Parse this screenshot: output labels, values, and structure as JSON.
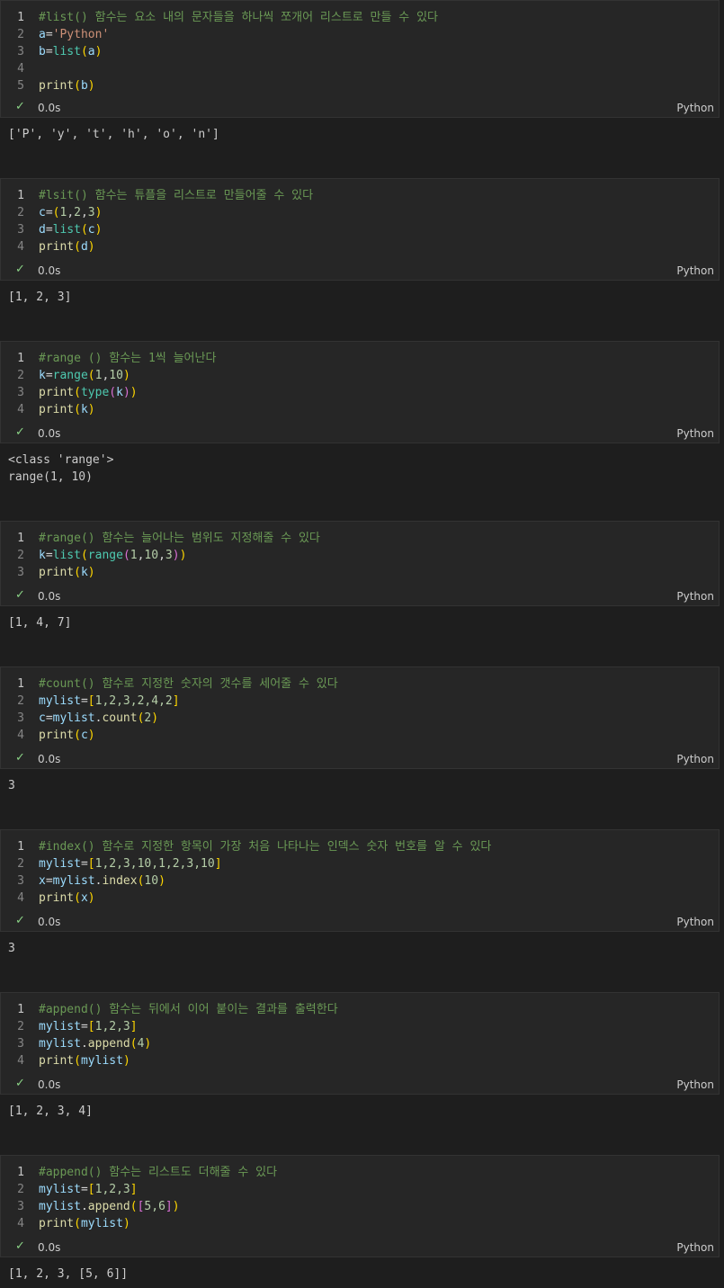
{
  "cells": [
    {
      "status": {
        "time": "0.0s",
        "language": "Python"
      },
      "output": [
        "['P', 'y', 't', 'h', 'o', 'n']"
      ]
    },
    {
      "status": {
        "time": "0.0s",
        "language": "Python"
      },
      "output": [
        "[1, 2, 3]"
      ]
    },
    {
      "status": {
        "time": "0.0s",
        "language": "Python"
      },
      "output": [
        "<class 'range'>",
        "range(1, 10)"
      ]
    },
    {
      "status": {
        "time": "0.0s",
        "language": "Python"
      },
      "output": [
        "[1, 4, 7]"
      ]
    },
    {
      "status": {
        "time": "0.0s",
        "language": "Python"
      },
      "output": [
        "3"
      ]
    },
    {
      "status": {
        "time": "0.0s",
        "language": "Python"
      },
      "output": [
        "3"
      ]
    },
    {
      "status": {
        "time": "0.0s",
        "language": "Python"
      },
      "output": [
        "[1, 2, 3, 4]"
      ]
    },
    {
      "status": {
        "time": "0.0s",
        "language": "Python"
      },
      "output": [
        "[1, 2, 3, [5, 6]]"
      ]
    }
  ],
  "code": {
    "c0": {
      "l1": {
        "cm": "#list() 함수는 요소 내의 문자들을 하나씩 쪼개어 리스트로 만들 수 있다"
      },
      "l2": {
        "a": "a",
        "eq": "=",
        "s": "'Python'"
      },
      "l3": {
        "b": "b",
        "eq": "=",
        "f": "list",
        "o": "(",
        "a": "a",
        "c": ")"
      },
      "l5": {
        "f": "print",
        "o": "(",
        "b": "b",
        "c": ")"
      }
    },
    "c1": {
      "l1": {
        "cm": "#lsit() 함수는 튜플을 리스트로 만들어줄 수 있다"
      },
      "l2": {
        "c": "c",
        "eq": "=",
        "o": "(",
        "n1": "1",
        "k1": ",",
        "n2": "2",
        "k2": ",",
        "n3": "3",
        "cl": ")"
      },
      "l3": {
        "d": "d",
        "eq": "=",
        "f": "list",
        "o": "(",
        "c": "c",
        "cl": ")"
      },
      "l4": {
        "f": "print",
        "o": "(",
        "d": "d",
        "cl": ")"
      }
    },
    "c2": {
      "l1": {
        "cm": "#range () 함수는 1씩 늘어난다"
      },
      "l2": {
        "k": "k",
        "eq": "=",
        "f": "range",
        "o": "(",
        "n1": "1",
        "k1": ",",
        "n2": "10",
        "cl": ")"
      },
      "l3": {
        "f": "print",
        "o": "(",
        "t": "type",
        "o2": "(",
        "k": "k",
        "c2": ")",
        "cl": ")"
      },
      "l4": {
        "f": "print",
        "o": "(",
        "k": "k",
        "cl": ")"
      }
    },
    "c3": {
      "l1": {
        "cm": "#range() 함수는 늘어나는 범위도 지정해줄 수 있다"
      },
      "l2": {
        "k": "k",
        "eq": "=",
        "f": "list",
        "o": "(",
        "r": "range",
        "o2": "(",
        "n1": "1",
        "k1": ",",
        "n2": "10",
        "k2": ",",
        "n3": "3",
        "c2": ")",
        "cl": ")"
      },
      "l3": {
        "f": "print",
        "o": "(",
        "k": "k",
        "cl": ")"
      }
    },
    "c4": {
      "l1": {
        "cm": "#count() 함수로 지정한 숫자의 갯수를 세어줄 수 있다"
      },
      "l2": {
        "v": "mylist",
        "eq": "=",
        "o": "[",
        "nums": "1,2,3,2,4,2",
        "cl": "]"
      },
      "l3": {
        "c": "c",
        "eq": "=",
        "v": "mylist",
        "dot": ".",
        "f": "count",
        "o": "(",
        "n": "2",
        "cl": ")"
      },
      "l4": {
        "f": "print",
        "o": "(",
        "c": "c",
        "cl": ")"
      }
    },
    "c5": {
      "l1": {
        "cm": "#index() 함수로 지정한 항목이 가장 처음 나타나는 인덱스 숫자 번호를 알 수 있다"
      },
      "l2": {
        "v": "mylist",
        "eq": "=",
        "o": "[",
        "nums": "1,2,3,10,1,2,3,10",
        "cl": "]"
      },
      "l3": {
        "x": "x",
        "eq": "=",
        "v": "mylist",
        "dot": ".",
        "f": "index",
        "o": "(",
        "n": "10",
        "cl": ")"
      },
      "l4": {
        "f": "print",
        "o": "(",
        "x": "x",
        "cl": ")"
      }
    },
    "c6": {
      "l1": {
        "cm": "#append() 함수는 뒤에서 이어 붙이는 결과를 출력한다"
      },
      "l2": {
        "v": "mylist",
        "eq": "=",
        "o": "[",
        "nums": "1,2,3",
        "cl": "]"
      },
      "l3": {
        "v": "mylist",
        "dot": ".",
        "f": "append",
        "o": "(",
        "n": "4",
        "cl": ")"
      },
      "l4": {
        "f": "print",
        "o": "(",
        "v": "mylist",
        "cl": ")"
      }
    },
    "c7": {
      "l1": {
        "cm": "#append() 함수는 리스트도 더해줄 수 있다"
      },
      "l2": {
        "v": "mylist",
        "eq": "=",
        "o": "[",
        "nums": "1,2,3",
        "cl": "]"
      },
      "l3": {
        "v": "mylist",
        "dot": ".",
        "f": "append",
        "o": "(",
        "o2": "[",
        "nums": "5,6",
        "c2": "]",
        "cl": ")"
      },
      "l4": {
        "f": "print",
        "o": "(",
        "v": "mylist",
        "cl": ")"
      }
    }
  },
  "line_numbers": [
    "1",
    "2",
    "3",
    "4",
    "5"
  ],
  "icons": {
    "status_check": "check-icon"
  },
  "colors": {
    "background": "#1e1e1e",
    "cell": "#262626",
    "comment": "#6a9955",
    "check": "#89d185"
  }
}
